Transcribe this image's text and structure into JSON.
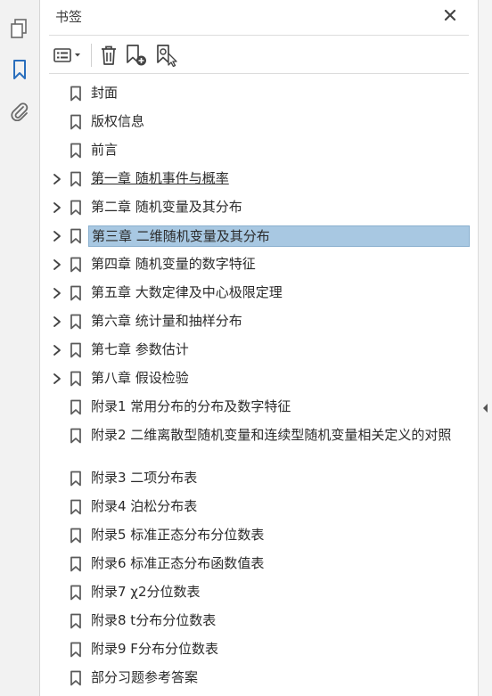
{
  "panel": {
    "title": "书签"
  },
  "rail": {
    "icons": [
      "pages-icon",
      "bookmark-icon",
      "attachment-icon"
    ],
    "active": "bookmark-icon",
    "accent": "#2a6fbd"
  },
  "toolbar": {
    "icons": [
      "options-menu-icon",
      "delete-icon",
      "new-bookmark-icon",
      "new-bookmark-from-structure-icon"
    ]
  },
  "bookmarks": [
    {
      "label": "封面",
      "expandable": false
    },
    {
      "label": "版权信息",
      "expandable": false
    },
    {
      "label": "前言",
      "expandable": false
    },
    {
      "label": "第一章 随机事件与概率",
      "expandable": true,
      "underlined": true
    },
    {
      "label": "第二章 随机变量及其分布",
      "expandable": true
    },
    {
      "label": "第三章 二维随机变量及其分布",
      "expandable": true,
      "selected": true
    },
    {
      "label": "第四章 随机变量的数字特征",
      "expandable": true
    },
    {
      "label": "第五章 大数定律及中心极限定理",
      "expandable": true
    },
    {
      "label": "第六章 统计量和抽样分布",
      "expandable": true
    },
    {
      "label": "第七章 参数估计",
      "expandable": true
    },
    {
      "label": "第八章 假设检验",
      "expandable": true
    },
    {
      "label": "附录1 常用分布的分布及数字特征",
      "expandable": false
    },
    {
      "label": "附录2 二维离散型随机变量和连续型随机变量相关定义的对照",
      "expandable": false,
      "wrap": true
    },
    {
      "label": "附录3 二项分布表",
      "expandable": false
    },
    {
      "label": "附录4 泊松分布表",
      "expandable": false
    },
    {
      "label": "附录5 标准正态分布分位数表",
      "expandable": false
    },
    {
      "label": "附录6 标准正态分布函数值表",
      "expandable": false
    },
    {
      "label": "附录7 χ2分位数表",
      "expandable": false
    },
    {
      "label": "附录8 t分布分位数表",
      "expandable": false
    },
    {
      "label": "附录9 F分布分位数表",
      "expandable": false
    },
    {
      "label": "部分习题参考答案",
      "expandable": false
    }
  ]
}
